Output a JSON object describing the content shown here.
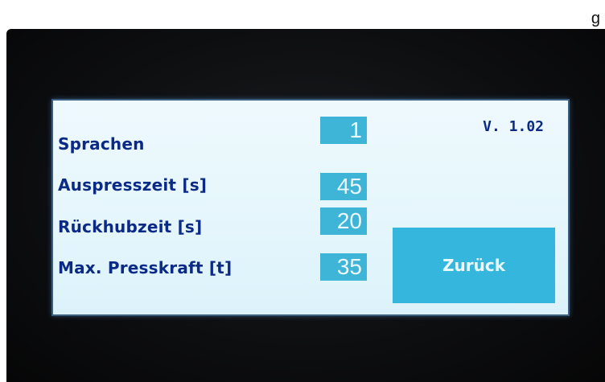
{
  "corner_text": "g",
  "version": "V. 1.02",
  "params": [
    {
      "label": "Sprachen",
      "value": "1"
    },
    {
      "label": "Auspresszeit [s]",
      "value": "45"
    },
    {
      "label": "Rückhubzeit [s]",
      "value": "20"
    },
    {
      "label": "Max. Presskraft [t]",
      "value": "35"
    }
  ],
  "back_button": "Zurück",
  "colors": {
    "screen_bg": "#e4f6fc",
    "accent": "#3eb4d6",
    "label_text": "#0b2a86",
    "bezel": "#0d0e10"
  }
}
